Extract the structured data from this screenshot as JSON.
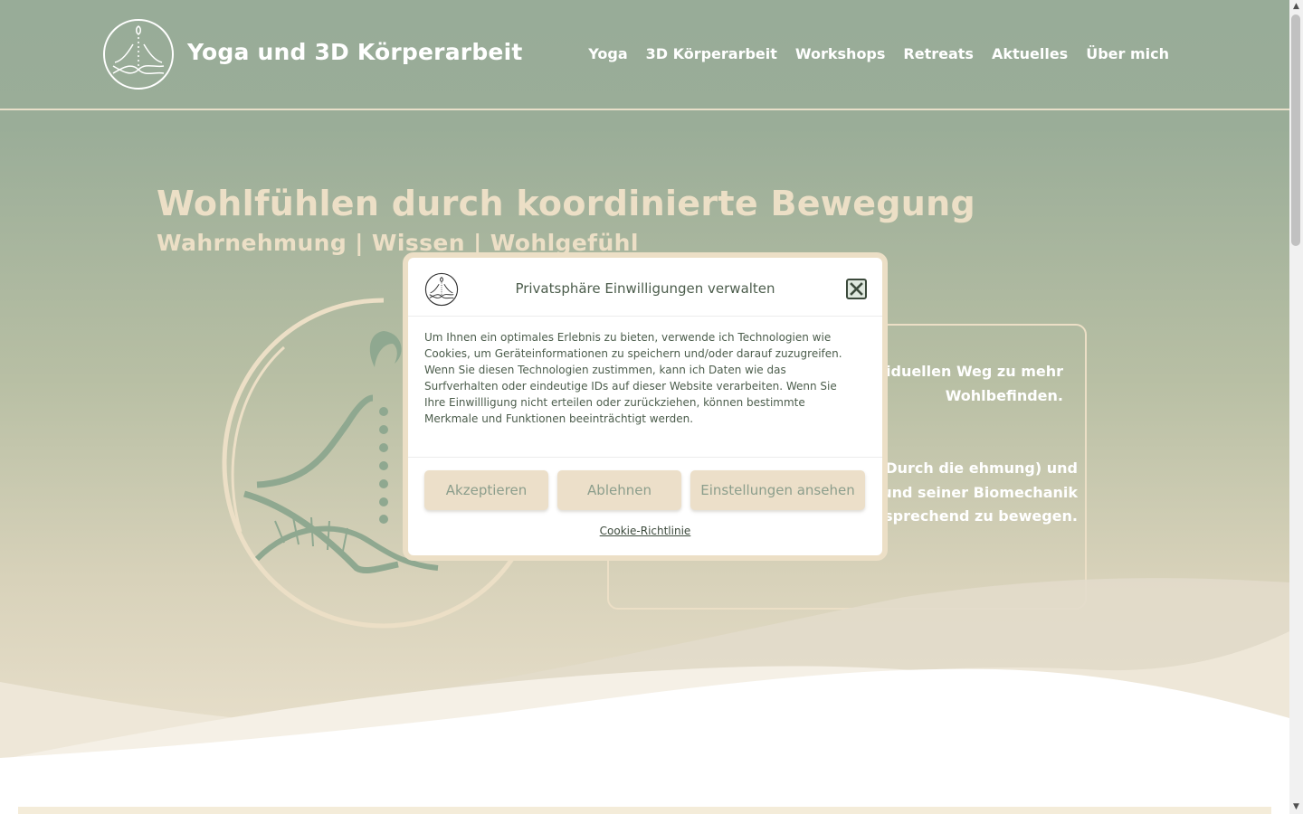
{
  "site": {
    "title": "Yoga und 3D Körperarbeit"
  },
  "nav": {
    "items": [
      {
        "label": "Yoga"
      },
      {
        "label": "3D Körperarbeit"
      },
      {
        "label": "Workshops"
      },
      {
        "label": "Retreats"
      },
      {
        "label": "Aktuelles"
      },
      {
        "label": "Über mich"
      }
    ]
  },
  "hero": {
    "heading": "Wohlfühlen durch koordinierte Bewegung",
    "subheading": "Wahrnehmung | Wissen | Wohlgefühl",
    "paragraph_1": "ege, ich unterstütze individuellen Weg zu mehr Wohlbefinden.",
    "paragraph_2": "herapiekonzept der eine Basis. Durch die ehmung) und ren Körper koordiniert und seiner Biomechanik entsprechend zu bewegen."
  },
  "consent": {
    "title": "Privatsphäre Einwilligungen verwalten",
    "body": "Um Ihnen ein optimales Erlebnis zu bieten, verwende ich Technologien wie Cookies, um Geräteinformationen zu speichern und/oder darauf zuzugreifen. Wenn Sie diesen Technologien zustimmen, kann ich Daten wie das Surfverhalten oder eindeutige IDs auf dieser Website verarbeiten. Wenn Sie Ihre Einwillligung nicht erteilen oder zurückziehen, können bestimmte Merkmale und Funktionen beeinträchtigt werden.",
    "accept_label": "Akzeptieren",
    "deny_label": "Ablehnen",
    "settings_label": "Einstellungen ansehen",
    "policy_link": "Cookie-Richtlinie"
  },
  "colors": {
    "header_green": "#9aad98",
    "cream": "#ecdfc6",
    "button_bg": "#ecdfc9",
    "button_text": "#8c9e8c",
    "dark_green_text": "#4c5d4c",
    "logo_sage": "#8fa890"
  },
  "icons": {
    "logo": "meditation-dna-logo-icon",
    "close": "close-icon"
  }
}
